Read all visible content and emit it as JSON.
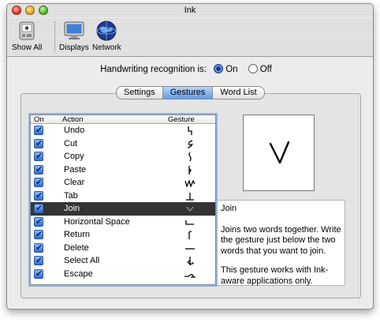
{
  "window": {
    "title": "Ink"
  },
  "toolbar": {
    "items": [
      {
        "label": "Show All",
        "icon": "show-all-icon"
      },
      {
        "label": "Displays",
        "icon": "displays-icon"
      },
      {
        "label": "Network",
        "icon": "network-icon"
      }
    ]
  },
  "recognition": {
    "label": "Handwriting recognition is:",
    "options": [
      "On",
      "Off"
    ],
    "selected": "On"
  },
  "tabs": [
    {
      "label": "Settings",
      "selected": false
    },
    {
      "label": "Gestures",
      "selected": true
    },
    {
      "label": "Word List",
      "selected": false
    }
  ],
  "table": {
    "headers": {
      "on": "On",
      "action": "Action",
      "gesture": "Gesture"
    },
    "rows": [
      {
        "action": "Undo",
        "checked": true,
        "gesture_icon": "undo-gesture-icon"
      },
      {
        "action": "Cut",
        "checked": true,
        "gesture_icon": "cut-gesture-icon"
      },
      {
        "action": "Copy",
        "checked": true,
        "gesture_icon": "copy-gesture-icon"
      },
      {
        "action": "Paste",
        "checked": true,
        "gesture_icon": "paste-gesture-icon"
      },
      {
        "action": "Clear",
        "checked": true,
        "gesture_icon": "clear-gesture-icon"
      },
      {
        "action": "Tab",
        "checked": true,
        "gesture_icon": "tab-gesture-icon"
      },
      {
        "action": "Join",
        "checked": true,
        "gesture_icon": "join-gesture-icon",
        "selected": true
      },
      {
        "action": "Horizontal Space",
        "checked": true,
        "gesture_icon": "horizontal-space-gesture-icon"
      },
      {
        "action": "Return",
        "checked": true,
        "gesture_icon": "return-gesture-icon"
      },
      {
        "action": "Delete",
        "checked": true,
        "gesture_icon": "delete-gesture-icon"
      },
      {
        "action": "Select All",
        "checked": true,
        "gesture_icon": "select-all-gesture-icon"
      },
      {
        "action": "Escape",
        "checked": true,
        "gesture_icon": "escape-gesture-icon"
      }
    ]
  },
  "description": {
    "title": "Join",
    "body1": "Joins two words together. Write the gesture just below the two words that you want to join.",
    "body2": "This gesture works with Ink-aware applications only."
  },
  "colors": {
    "selection": "#333333",
    "tab_selected": "#5d9be8",
    "checkbox": "#2f6ad6"
  }
}
